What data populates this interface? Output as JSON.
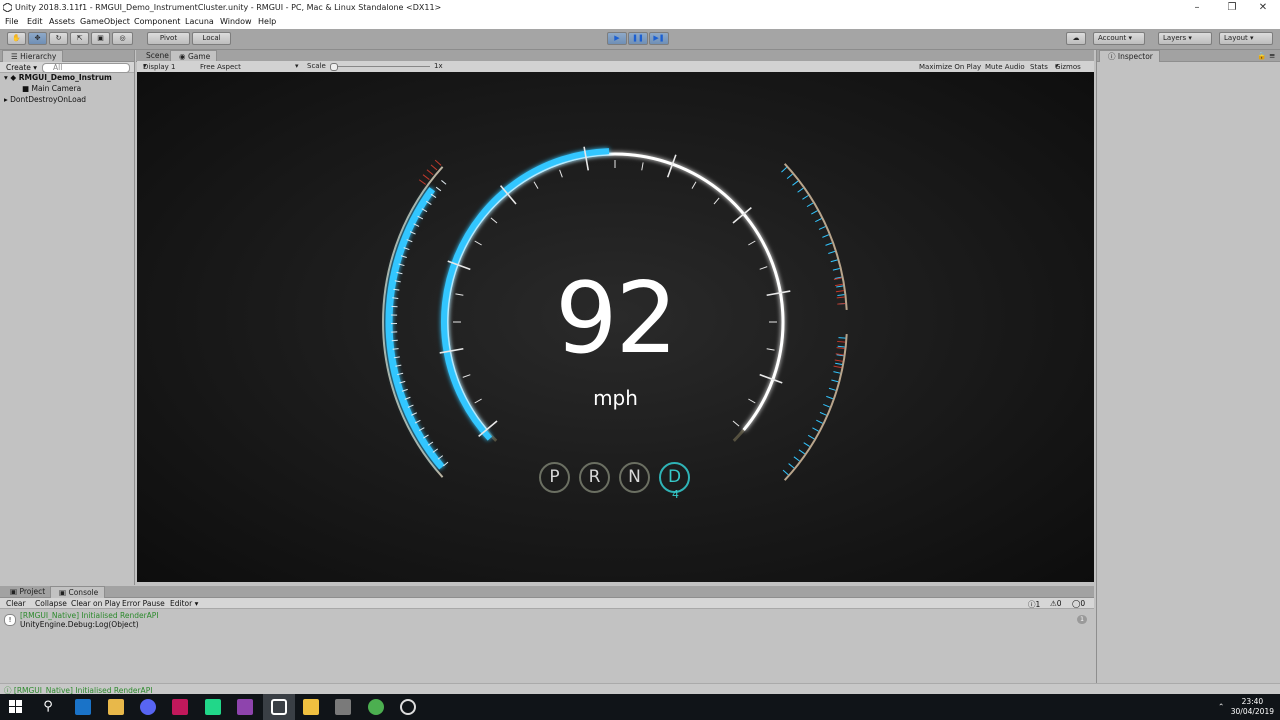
{
  "window": {
    "title": "Unity 2018.3.11f1 - RMGUI_Demo_InstrumentCluster.unity - RMGUI - PC, Mac & Linux Standalone <DX11>"
  },
  "menu": [
    "File",
    "Edit",
    "Assets",
    "GameObject",
    "Component",
    "Lacuna",
    "Window",
    "Help"
  ],
  "toolbar": {
    "pivot": "Pivot",
    "local": "Local",
    "account": "Account",
    "layers": "Layers",
    "layout": "Layout"
  },
  "hierarchy": {
    "tab": "Hierarchy",
    "create": "Create",
    "search_placeholder": "All",
    "items": [
      "RMGUI_Demo_Instrum",
      "Main Camera",
      "DontDestroyOnLoad"
    ]
  },
  "scene_tabs": [
    "Scene",
    "Game"
  ],
  "game_toolbar": {
    "display": "Display 1",
    "aspect": "Free Aspect",
    "scale_label": "Scale",
    "scale_value": "1x",
    "maximize": "Maximize On Play",
    "mute": "Mute Audio",
    "stats": "Stats",
    "gizmos": "Gizmos"
  },
  "inspector": {
    "tab": "Inspector"
  },
  "dashboard": {
    "speed": "92",
    "unit": "mph",
    "speed_fraction": 0.62,
    "gears": [
      "P",
      "R",
      "N",
      "D"
    ],
    "active_gear": "D",
    "gear_number": "4",
    "colors": {
      "accent": "#33c6ff",
      "gear_active": "#2fb3b6",
      "redline": "#c0392b"
    }
  },
  "bottom_tabs": [
    "Project",
    "Console"
  ],
  "console": {
    "buttons": [
      "Clear",
      "Collapse",
      "Clear on Play",
      "Error Pause",
      "Editor"
    ],
    "counts": [
      "1",
      "0",
      "0"
    ],
    "log_line1": "[RMGUI_Native] Initialised RenderAPI",
    "log_line2": "UnityEngine.Debug:Log(Object)",
    "log_count": "1"
  },
  "status": {
    "message": "[RMGUI_Native] Initialised RenderAPI"
  },
  "taskbar": {
    "time": "23:40",
    "date": "30/04/2019"
  }
}
